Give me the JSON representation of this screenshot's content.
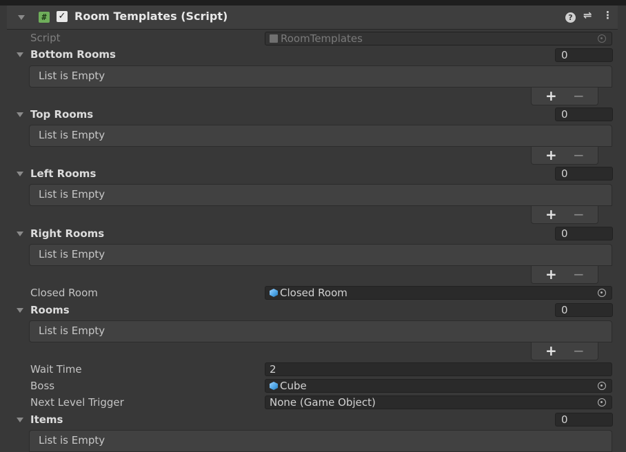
{
  "component": {
    "title": "Room Templates (Script)",
    "icons": [
      "script-icon",
      "enabled-checkbox",
      "help-icon",
      "settings-icon",
      "more-icon"
    ]
  },
  "script_field": {
    "label": "Script",
    "value": "RoomTemplates"
  },
  "bottom_rooms": {
    "label": "Bottom Rooms",
    "count": "0",
    "empty_text": "List is Empty",
    "add": "+",
    "remove": "−"
  },
  "top_rooms": {
    "label": "Top Rooms",
    "count": "0",
    "empty_text": "List is Empty",
    "add": "+",
    "remove": "−"
  },
  "left_rooms": {
    "label": "Left Rooms",
    "count": "0",
    "empty_text": "List is Empty",
    "add": "+",
    "remove": "−"
  },
  "right_rooms": {
    "label": "Right Rooms",
    "count": "0",
    "empty_text": "List is Empty",
    "add": "+",
    "remove": "−"
  },
  "closed_room": {
    "label": "Closed Room",
    "value": "Closed Room"
  },
  "rooms": {
    "label": "Rooms",
    "count": "0",
    "empty_text": "List is Empty",
    "add": "+",
    "remove": "−"
  },
  "wait_time": {
    "label": "Wait Time",
    "value": "2"
  },
  "boss": {
    "label": "Boss",
    "value": "Cube"
  },
  "next_level_trigger": {
    "label": "Next Level Trigger",
    "value": "None (Game Object)"
  },
  "items": {
    "label": "Items",
    "count": "0",
    "empty_text": "List is Empty"
  },
  "colors": {
    "panel": "#383838",
    "field": "#2a2a2a",
    "list": "#414141",
    "script_icon": "#6fae5b",
    "object_icon": "#4ba4e6"
  }
}
